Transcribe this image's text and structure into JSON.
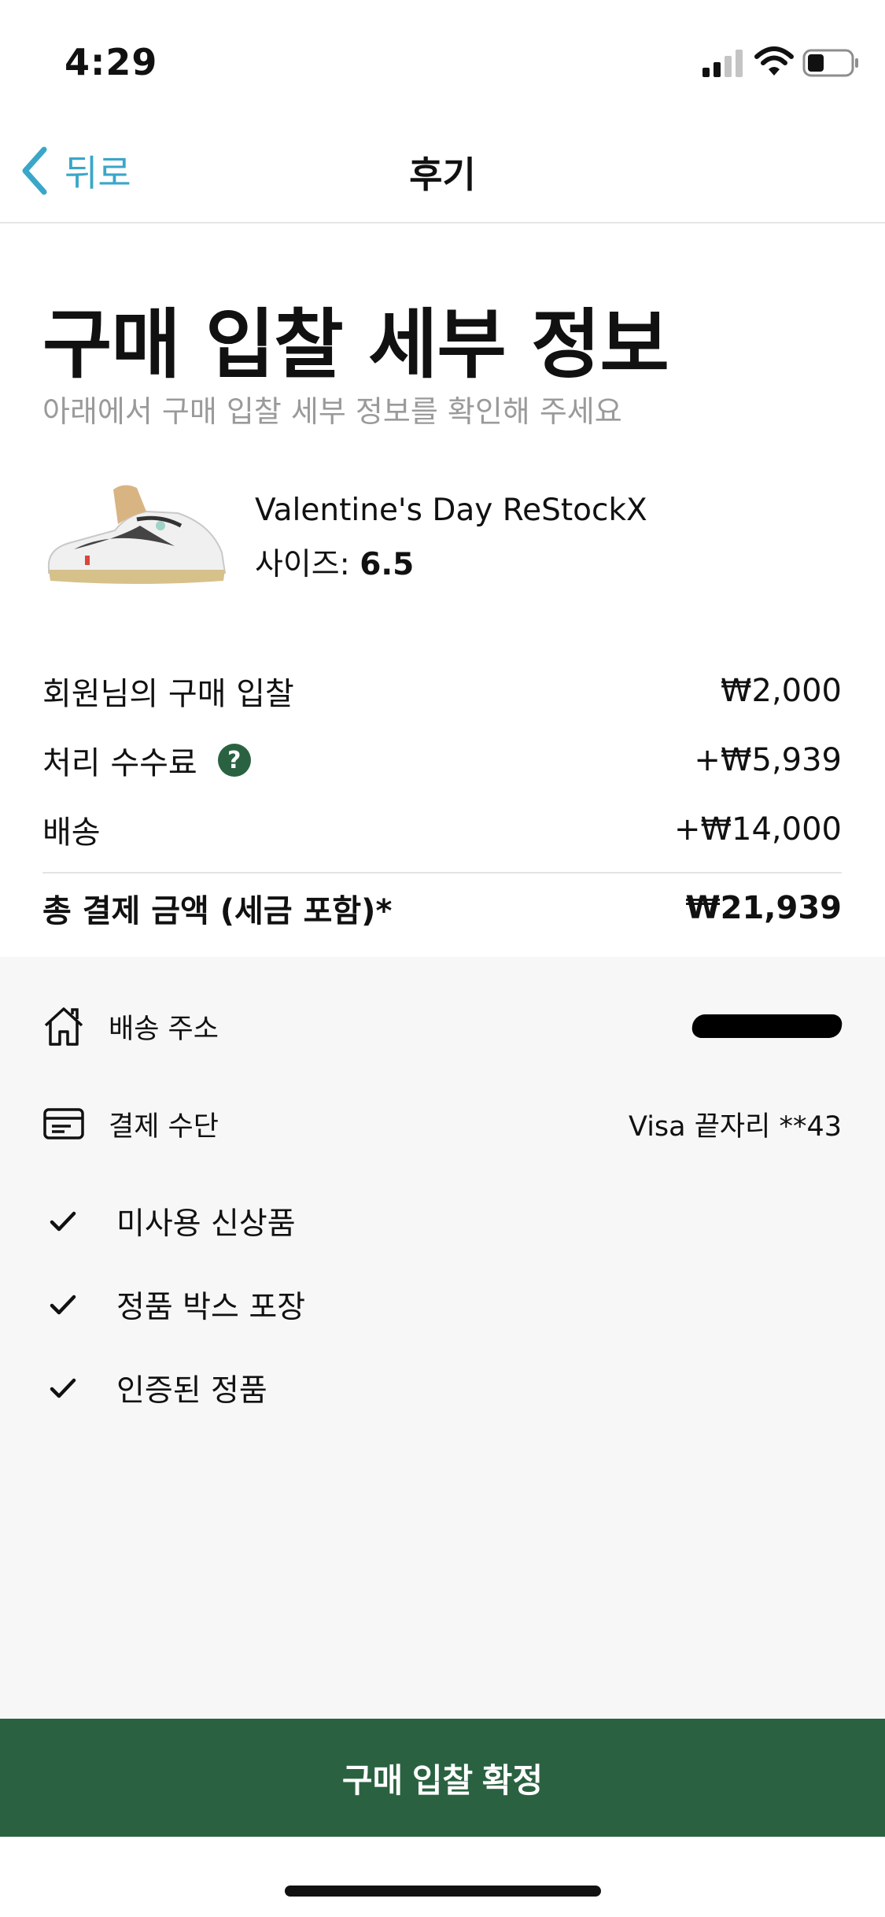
{
  "status_bar": {
    "time": "4:29",
    "icons": [
      "signal-icon",
      "wifi-icon",
      "battery-icon"
    ]
  },
  "nav": {
    "back_label": "뒤로",
    "title": "후기",
    "back_icon": "chevron-left-icon",
    "accent_color": "#3aa6c9"
  },
  "header": {
    "title": "구매 입찰 세부 정보",
    "subtitle": "아래에서 구매 입찰 세부 정보를 확인해 주세요"
  },
  "product": {
    "name": "Valentine's Day ReStockX",
    "size_label": "사이즈:",
    "size_value": "6.5"
  },
  "pricing": {
    "bid_label": "회원님의 구매 입찰",
    "bid_value": "₩2,000",
    "fee_label": "처리 수수료",
    "fee_value": "+₩5,939",
    "shipping_label": "배송",
    "shipping_value": "+₩14,000",
    "total_label": "총 결제 금액 (세금 포함)*",
    "total_value": "₩21,939"
  },
  "details": {
    "address_label": "배송 주소",
    "payment_label": "결제 수단",
    "payment_value": "Visa 끝자리 **43"
  },
  "checklist": [
    {
      "label": "미사용 신상품"
    },
    {
      "label": "정품 박스 포장"
    },
    {
      "label": "인증된 정품"
    }
  ],
  "cta": {
    "label": "구매 입찰 확정",
    "color": "#2a6241"
  }
}
